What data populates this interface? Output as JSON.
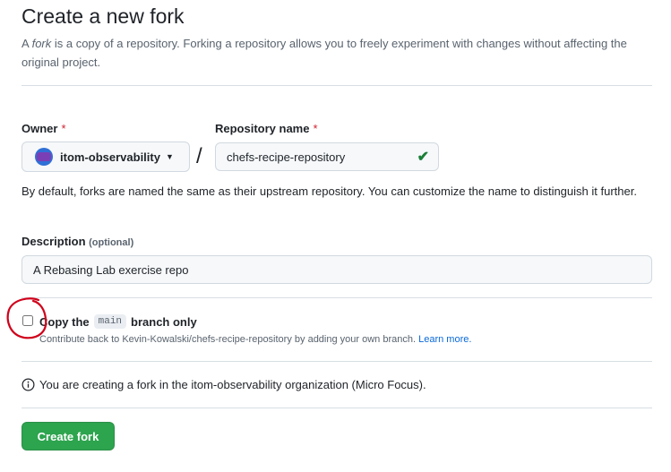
{
  "header": {
    "title": "Create a new fork",
    "subtitle_prefix": "A ",
    "subtitle_em": "fork",
    "subtitle_rest": " is a copy of a repository. Forking a repository allows you to freely experiment with changes without affecting the original project."
  },
  "owner": {
    "label": "Owner",
    "required_mark": "*",
    "selected": "itom-observability",
    "icon": "chevron-down-icon"
  },
  "repo": {
    "label": "Repository name",
    "required_mark": "*",
    "value": "chefs-recipe-repository",
    "valid_icon": "check-icon",
    "slash": "/"
  },
  "help_text": "By default, forks are named the same as their upstream repository. You can customize the name to distinguish it further.",
  "description": {
    "label": "Description",
    "optional": "(optional)",
    "value": "A Rebasing Lab exercise repo"
  },
  "copy_branch": {
    "checked": false,
    "label_before": "Copy the",
    "branch": "main",
    "label_after": "branch only",
    "note": "Contribute back to Kevin-Kowalski/chefs-recipe-repository by adding your own branch.",
    "learn_more": "Learn more."
  },
  "info": {
    "text": "You are creating a fork in the itom-observability organization (Micro Focus).",
    "icon": "info-icon"
  },
  "submit": {
    "label": "Create fork"
  },
  "colors": {
    "primary_button": "#2da44e",
    "required": "#cf222e",
    "link": "#0969da",
    "annotation": "#d0021b"
  }
}
